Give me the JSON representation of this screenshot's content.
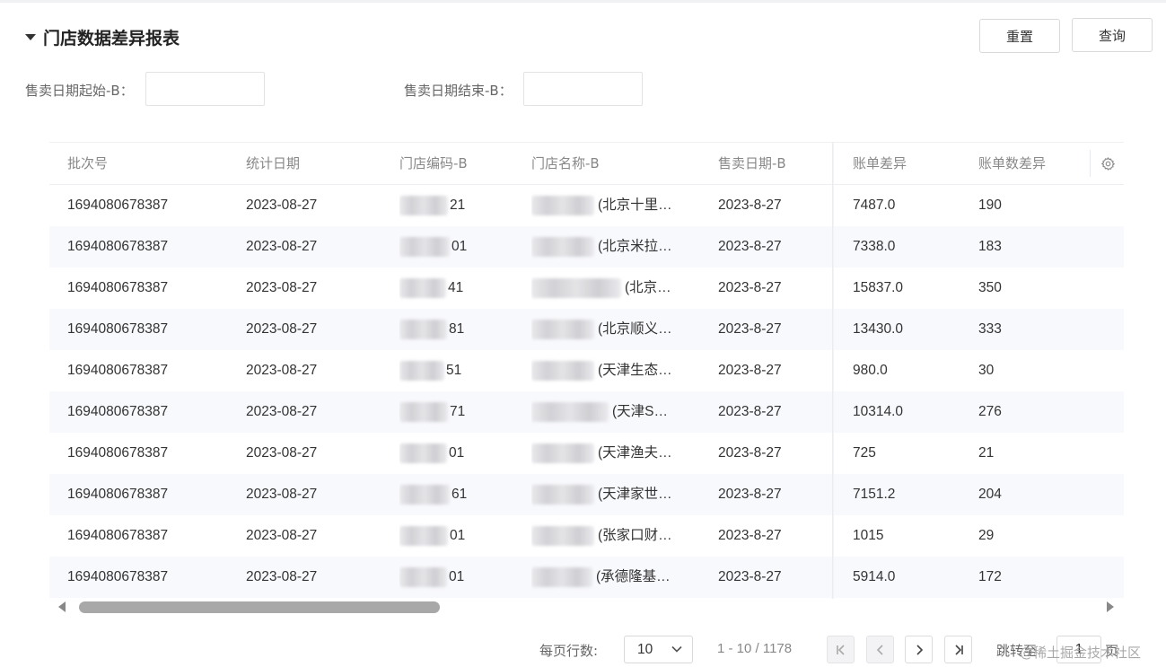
{
  "report": {
    "title": "门店数据差异报表",
    "reset_label": "重置",
    "query_label": "查询"
  },
  "filters": {
    "start_label": "售卖日期起始-B：",
    "start_value": "",
    "end_label": "售卖日期结束-B：",
    "end_value": ""
  },
  "table": {
    "columns": [
      "批次号",
      "统计日期",
      "门店编码-B",
      "门店名称-B",
      "售卖日期-B",
      "账单差异",
      "账单数差异"
    ],
    "settings_icon": "gear-icon",
    "rows": [
      {
        "batch": "1694080678387",
        "stat_date": "2023-08-27",
        "code_suffix": "21",
        "name_suffix": "(北京十里…",
        "sale_date": "2023-8-27",
        "bill_diff": "7487.0",
        "bill_count_diff": "190"
      },
      {
        "batch": "1694080678387",
        "stat_date": "2023-08-27",
        "code_suffix": "01",
        "name_suffix": "(北京米拉…",
        "sale_date": "2023-8-27",
        "bill_diff": "7338.0",
        "bill_count_diff": "183"
      },
      {
        "batch": "1694080678387",
        "stat_date": "2023-08-27",
        "code_suffix": "41",
        "name_suffix": "(北京…",
        "sale_date": "2023-8-27",
        "bill_diff": "15837.0",
        "bill_count_diff": "350"
      },
      {
        "batch": "1694080678387",
        "stat_date": "2023-08-27",
        "code_suffix": "81",
        "name_suffix": "(北京顺义…",
        "sale_date": "2023-8-27",
        "bill_diff": "13430.0",
        "bill_count_diff": "333"
      },
      {
        "batch": "1694080678387",
        "stat_date": "2023-08-27",
        "code_suffix": "51",
        "name_suffix": "(天津生态…",
        "sale_date": "2023-8-27",
        "bill_diff": "980.0",
        "bill_count_diff": "30"
      },
      {
        "batch": "1694080678387",
        "stat_date": "2023-08-27",
        "code_suffix": "71",
        "name_suffix": "(天津S…",
        "sale_date": "2023-8-27",
        "bill_diff": "10314.0",
        "bill_count_diff": "276"
      },
      {
        "batch": "1694080678387",
        "stat_date": "2023-08-27",
        "code_suffix": "01",
        "name_suffix": "(天津渔夫…",
        "sale_date": "2023-8-27",
        "bill_diff": "725",
        "bill_count_diff": "21"
      },
      {
        "batch": "1694080678387",
        "stat_date": "2023-08-27",
        "code_suffix": "61",
        "name_suffix": "(天津家世…",
        "sale_date": "2023-8-27",
        "bill_diff": "7151.2",
        "bill_count_diff": "204"
      },
      {
        "batch": "1694080678387",
        "stat_date": "2023-08-27",
        "code_suffix": "01",
        "name_suffix": "(张家口财…",
        "sale_date": "2023-8-27",
        "bill_diff": "1015",
        "bill_count_diff": "29"
      },
      {
        "batch": "1694080678387",
        "stat_date": "2023-08-27",
        "code_suffix": "01",
        "name_suffix": "(承德隆基…",
        "sale_date": "2023-8-27",
        "bill_diff": "5914.0",
        "bill_count_diff": "172"
      }
    ]
  },
  "pagination": {
    "rows_per_page_label": "每页行数:",
    "rows_per_page": "10",
    "range_text": "1 - 10 / 1178",
    "jump_label": "跳转至",
    "jump_value": "1",
    "page_unit": "页"
  },
  "watermark": "@稀土掘金技术社区"
}
